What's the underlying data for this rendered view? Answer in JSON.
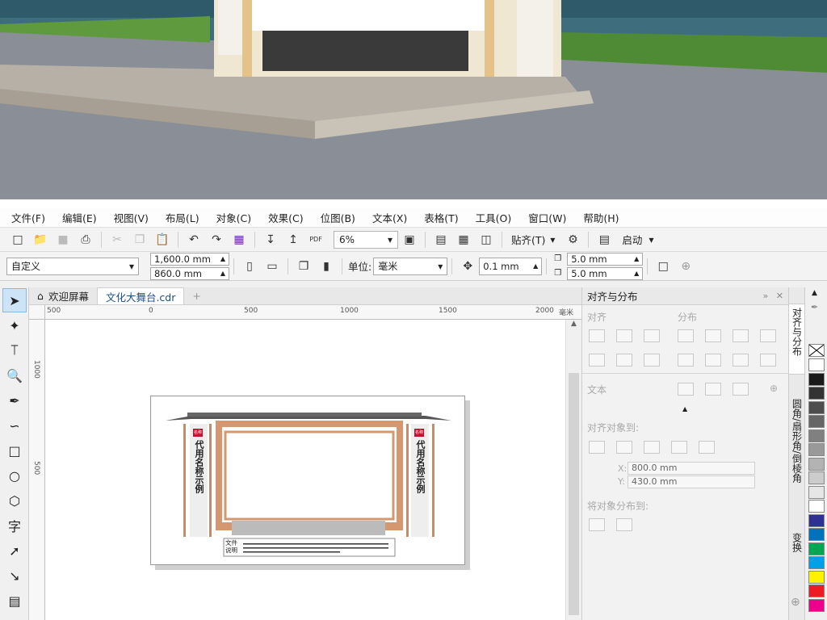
{
  "menu": [
    "文件(F)",
    "编辑(E)",
    "视图(V)",
    "布局(L)",
    "对象(C)",
    "效果(C)",
    "位图(B)",
    "文本(X)",
    "表格(T)",
    "工具(O)",
    "窗口(W)",
    "帮助(H)"
  ],
  "toolbar": {
    "zoom": "6%",
    "snap_label": "贴齐(T)",
    "launch_label": "启动",
    "pdf_label": "PDF"
  },
  "propbar": {
    "page_preset": "自定义",
    "width": "1,600.0 mm",
    "height": "860.0 mm",
    "unit_label": "单位:",
    "unit_value": "毫米",
    "nudge": "0.1 mm",
    "dup_x": "5.0 mm",
    "dup_y": "5.0 mm"
  },
  "tabs": {
    "welcome": "欢迎屏幕",
    "document": "文化大舞台.cdr",
    "add": "+"
  },
  "ruler": {
    "h_ticks": [
      "500",
      "0",
      "500",
      "1000",
      "1500",
      "2000"
    ],
    "h_unit": "毫米",
    "v_ticks": [
      "1000",
      "500"
    ]
  },
  "design": {
    "title_left": "代用名称示例",
    "title_right": "代用名称示例",
    "seal": "名称",
    "caption": "文件说明",
    "tile_caption": "文件说明"
  },
  "docker": {
    "title": "对齐与分布",
    "align": "对齐",
    "distribute": "分布",
    "text": "文本",
    "align_to": "对齐对象到:",
    "x_label": "X:",
    "x_value": "800.0 mm",
    "y_label": "Y:",
    "y_value": "430.0 mm",
    "distribute_to": "将对象分布到:"
  },
  "vtabs": [
    "对齐与分布",
    "圆角/扇形角/倒棱角",
    "变换"
  ],
  "palette": [
    "#ffffff",
    "#1a1a1a",
    "#333333",
    "#4d4d4d",
    "#666666",
    "#808080",
    "#999999",
    "#b3b3b3",
    "#cccccc",
    "#e6e6e6",
    "#ffffff",
    "#2e3192",
    "#0072bc",
    "#00a651",
    "#00a0e9",
    "#fff200",
    "#ed1c24",
    "#ec008c"
  ]
}
